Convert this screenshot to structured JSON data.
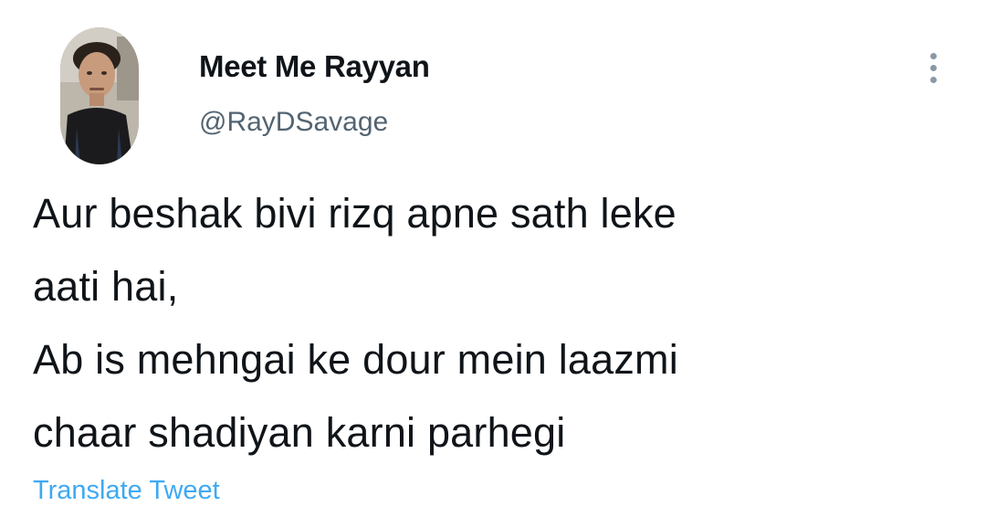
{
  "tweet": {
    "author": {
      "display_name": "Meet Me Rayyan",
      "handle": "@RayDSavage",
      "avatar": "profile-photo"
    },
    "more_icon": "more-vertical-icon",
    "text_lines": [
      "Aur beshak bivi rizq apne sath leke",
      "aati hai,",
      "Ab is mehngai ke dour mein laazmi",
      "chaar shadiyan karni parhegi"
    ],
    "translate_label": "Translate Tweet"
  },
  "colors": {
    "text_primary": "#0f1419",
    "text_secondary": "#536471",
    "link": "#1d9bf0",
    "background": "#ffffff"
  }
}
